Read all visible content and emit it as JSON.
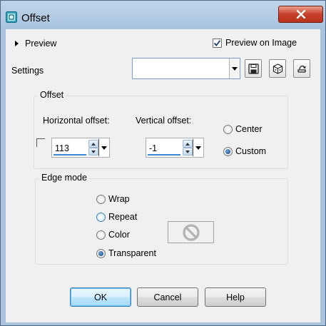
{
  "window": {
    "title": "Offset",
    "close_icon": "close-x-icon",
    "app_icon": "offset-app-icon"
  },
  "top": {
    "preview_label": "Preview",
    "preview_on_image_label": "Preview on Image",
    "preview_on_image_checked": true,
    "settings_label": "Settings",
    "settings_value": "",
    "tool_icons": [
      "save-icon",
      "reset-cube-icon",
      "restore-defaults-icon"
    ]
  },
  "offset": {
    "group_title": "Offset",
    "horizontal_label": "Horizontal offset:",
    "horizontal_value": "113",
    "vertical_label": "Vertical offset:",
    "vertical_value": "-1",
    "center_label": "Center",
    "custom_label": "Custom",
    "selected": "Custom"
  },
  "edge": {
    "group_title": "Edge mode",
    "options": [
      "Wrap",
      "Repeat",
      "Color",
      "Transparent"
    ],
    "selected": "Transparent",
    "hovered": "Repeat",
    "color_swatch_icon": "no-color-icon"
  },
  "buttons": {
    "ok": "OK",
    "cancel": "Cancel",
    "help": "Help"
  },
  "colors": {
    "accent": "#3a87d9",
    "close_red": "#c6402a",
    "title_gradient": "#a9c3df"
  }
}
